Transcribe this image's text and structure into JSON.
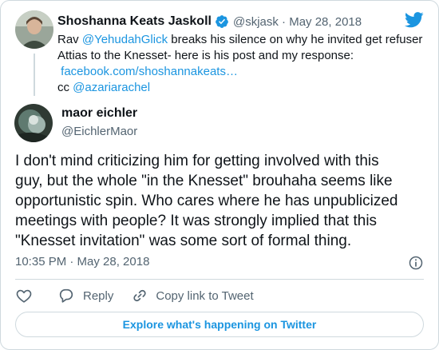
{
  "quoted_tweet": {
    "author_name": "Shoshanna Keats Jaskoll",
    "handle_date": "@skjask · May 28, 2018",
    "line1_prefix": "Rav ",
    "line1_mention": "@YehudahGlick",
    "line1_suffix": " breaks his silence on why he invited get refuser",
    "line2": "Attias to the Knesset- here is his post and my response:",
    "link": "facebook.com/shoshannakeats…",
    "cc_prefix": "cc ",
    "cc_mention": "@azariarachel"
  },
  "reply_tweet": {
    "author_name": "maor eichler",
    "handle": "@EichlerMaor",
    "body_lines": [
      "I don't mind criticizing him for getting involved with this",
      "guy, but the whole \"in the Knesset\" brouhaha seems like",
      "opportunistic spin. Who cares where he has unpublicized",
      "meetings with people? It was strongly implied that this",
      "\"Knesset invitation\" was some sort of formal thing."
    ],
    "timestamp": "10:35 PM · May 28, 2018"
  },
  "actions": {
    "reply_label": "Reply",
    "copy_label": "Copy link to Tweet"
  },
  "footer": {
    "explore_label": "Explore what's happening on Twitter"
  },
  "icons": {
    "verified": "verified-badge-icon",
    "brand": "twitter-bird-icon",
    "info": "info-icon",
    "like": "heart-icon",
    "reply": "reply-bubble-icon",
    "copy": "link-icon"
  },
  "colors": {
    "link": "#1b95e0",
    "muted": "#536471",
    "border": "#cfd9de"
  }
}
